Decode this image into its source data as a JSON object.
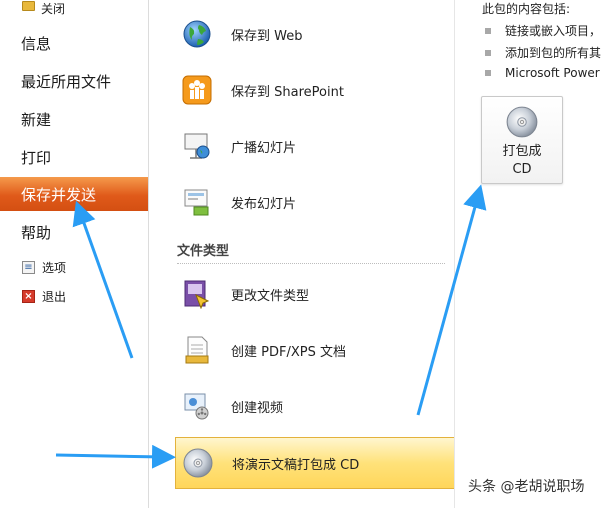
{
  "nav": {
    "close_label": "关闭",
    "items": [
      {
        "label": "信息"
      },
      {
        "label": "最近所用文件"
      },
      {
        "label": "新建"
      },
      {
        "label": "打印"
      },
      {
        "label": "保存并发送"
      },
      {
        "label": "帮助"
      }
    ],
    "active_index": 4,
    "options_label": "选项",
    "exit_label": "退出"
  },
  "middle": {
    "items": [
      {
        "label": "保存到 Web",
        "icon": "globe-icon"
      },
      {
        "label": "保存到 SharePoint",
        "icon": "sharepoint-icon"
      },
      {
        "label": "广播幻灯片",
        "icon": "broadcast-icon"
      },
      {
        "label": "发布幻灯片",
        "icon": "publish-slides-icon"
      }
    ],
    "section_title": "文件类型",
    "file_items": [
      {
        "label": "更改文件类型",
        "icon": "change-file-type-icon"
      },
      {
        "label": "创建 PDF/XPS 文档",
        "icon": "pdf-document-icon"
      },
      {
        "label": "创建视频",
        "icon": "video-icon"
      },
      {
        "label": "将演示文稿打包成 CD",
        "icon": "cd-icon"
      }
    ],
    "selected_label": "将演示文稿打包成 CD"
  },
  "right": {
    "heading": "此包的内容包括:",
    "bullets": [
      "链接或嵌入项目，",
      "添加到包的所有其",
      "Microsoft Power"
    ],
    "button_line1": "打包成",
    "button_line2": "CD"
  },
  "watermark": "头条 @老胡说职场",
  "colors": {
    "active_nav": "#e05a1a",
    "selected_item": "#ffd65a",
    "arrow": "#2a9df4"
  }
}
